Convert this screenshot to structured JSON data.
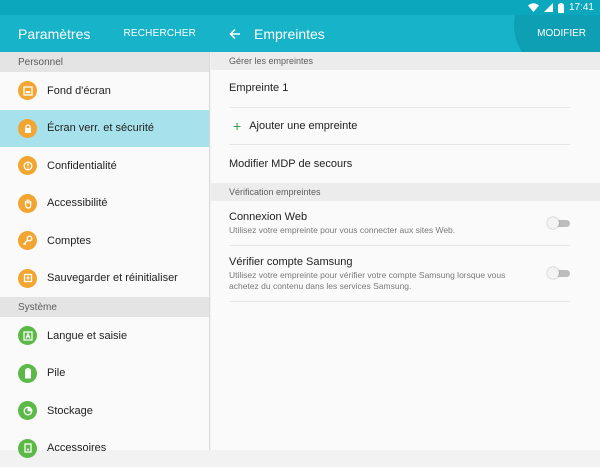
{
  "status_bar": {
    "time": "17:41"
  },
  "left_bar": {
    "title": "Paramètres",
    "action": "RECHERCHER"
  },
  "right_bar": {
    "title": "Empreintes",
    "action": "MODIFIER"
  },
  "left_panel": {
    "sections": [
      {
        "header": "Personnel",
        "items": [
          {
            "label": "Fond d'écran",
            "icon": "wallpaper-icon",
            "color": "#f3a531"
          },
          {
            "label": "Écran verr. et sécurité",
            "icon": "lock-icon",
            "color": "#f3a531",
            "active": true
          },
          {
            "label": "Confidentialité",
            "icon": "privacy-icon",
            "color": "#f3a531"
          },
          {
            "label": "Accessibilité",
            "icon": "hand-icon",
            "color": "#f3a531"
          },
          {
            "label": "Comptes",
            "icon": "key-icon",
            "color": "#f3a531"
          },
          {
            "label": "Sauvegarder et réinitialiser",
            "icon": "backup-icon",
            "color": "#f3a531"
          }
        ]
      },
      {
        "header": "Système",
        "items": [
          {
            "label": "Langue et saisie",
            "icon": "language-icon",
            "color": "#5cb947"
          },
          {
            "label": "Pile",
            "icon": "battery-icon",
            "color": "#5cb947"
          },
          {
            "label": "Stockage",
            "icon": "storage-icon",
            "color": "#5cb947"
          },
          {
            "label": "Accessoires",
            "icon": "accessories-icon",
            "color": "#5cb947"
          }
        ]
      }
    ]
  },
  "right_panel": {
    "manage_header": "Gérer les empreintes",
    "fingerprint_1": "Empreinte 1",
    "add_fingerprint": "Ajouter une empreinte",
    "backup_password": "Modifier MDP de secours",
    "verification_header": "Vérification empreintes",
    "web_login": {
      "title": "Connexion Web",
      "subtitle": "Utilisez votre empreinte pour vous connecter aux sites Web.",
      "enabled": false
    },
    "samsung_account": {
      "title": "Vérifier compte Samsung",
      "subtitle": "Utilisez votre empreinte pour vérifier votre compte Samsung lorsque vous achetez du contenu dans les services Samsung.",
      "enabled": false
    }
  }
}
